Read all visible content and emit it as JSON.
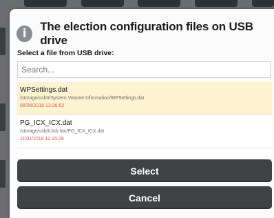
{
  "dialog": {
    "title": "The election configuration files on USB drive",
    "prompt": "Select a file from USB drive:",
    "icon": "info-icon"
  },
  "search": {
    "placeholder": "Search...",
    "value": ""
  },
  "files": [
    {
      "name": "WPSettings.dat",
      "path": "/storage/usb0/System Volume Information/WPSettings.dat",
      "date": "08/06/2018 13:36:52",
      "selected": true
    },
    {
      "name": "PG_ICX_ICX.dat",
      "path": "/storage/usb0/Job fair/PG_ICX_ICX.dat",
      "date": "11/01/2018 12:25:28",
      "selected": false
    }
  ],
  "buttons": {
    "select_label": "Select",
    "cancel_label": "Cancel"
  },
  "colors": {
    "selected_row": "#fdf3d0",
    "date_text": "#e2574c",
    "button_bg": "#3f4346"
  }
}
